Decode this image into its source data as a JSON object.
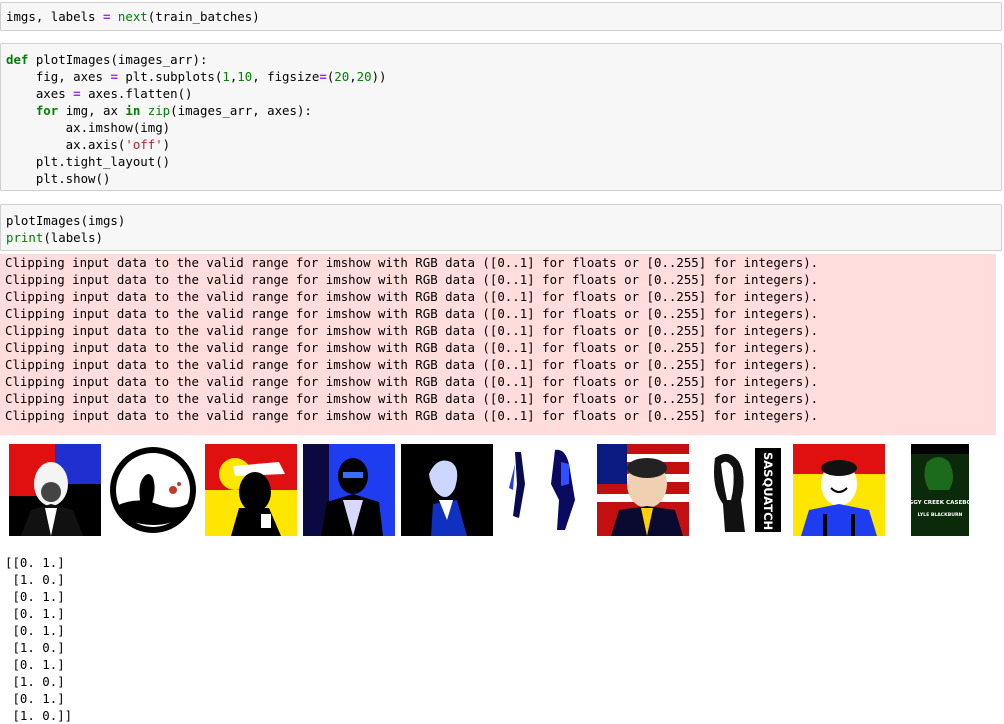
{
  "cells": {
    "cell1": {
      "line1": "imgs, labels = next(train_batches)"
    },
    "cell2": {
      "line1": "def plotImages(images_arr):",
      "line2": "    fig, axes = plt.subplots(1,10, figsize=(20,20))",
      "line3": "    axes = axes.flatten()",
      "line4": "    for img, ax in zip(images_arr, axes):",
      "line5": "        ax.imshow(img)",
      "line6": "        ax.axis('off')",
      "line7": "    plt.tight_layout()",
      "line8": "    plt.show()"
    },
    "cell3": {
      "line1": "plotImages(imgs)",
      "line2": "print(labels)"
    }
  },
  "stderr": {
    "line": "Clipping input data to the valid range for imshow with RGB data ([0..1] for floats or [0..255] for integers).",
    "count": 10
  },
  "figures": {
    "thumb4_text": "SASQUATCH",
    "thumb10_title": "BOGGY CREEK CASEBOOK",
    "thumb10_author": "LYLE BLACKBURN"
  },
  "stdout": {
    "lines": [
      "[[0. 1.]",
      " [1. 0.]",
      " [0. 1.]",
      " [0. 1.]",
      " [0. 1.]",
      " [1. 0.]",
      " [0. 1.]",
      " [1. 0.]",
      " [0. 1.]",
      " [1. 0.]]"
    ]
  },
  "colors": {
    "stderr_bg": "#ffdddd",
    "cell_bg": "#f7f7f7",
    "keyword": "#008000",
    "operator": "#aa22ff",
    "string": "#ba2121"
  }
}
